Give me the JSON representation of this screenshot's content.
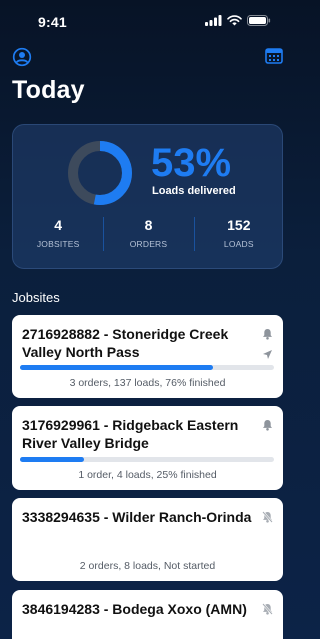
{
  "status_bar": {
    "time": "9:41"
  },
  "header": {
    "title": "Today"
  },
  "summary": {
    "percent_text": "53%",
    "percent_value": 53,
    "percent_label": "Loads delivered",
    "stats": [
      {
        "value": "4",
        "label": "JOBSITES"
      },
      {
        "value": "8",
        "label": "ORDERS"
      },
      {
        "value": "152",
        "label": "LOADS"
      }
    ]
  },
  "jobsites": {
    "section_title": "Jobsites",
    "items": [
      {
        "title": "2716928882 - Stoneridge Creek Valley North Pass",
        "meta": "3 orders, 137 loads, 76% finished",
        "progress": 0.76,
        "icons": [
          "bell-icon",
          "navigation-arrow-icon"
        ]
      },
      {
        "title": "3176929961 - Ridgeback Eastern River Valley Bridge",
        "meta": "1 order, 4 loads, 25% finished",
        "progress": 0.25,
        "icons": [
          "bell-icon"
        ]
      },
      {
        "title": "3338294635 - Wilder Ranch-Orinda",
        "meta": "2 orders, 8 loads, Not started",
        "icons": [
          "bell-slash-icon"
        ]
      },
      {
        "title": "3846194283 - Bodega Xoxo (AMN)",
        "icons": [
          "bell-slash-icon"
        ]
      }
    ]
  },
  "colors": {
    "accent": "#1e7cf2",
    "background": "#0b1f3c",
    "card": "#ffffff",
    "gauge_track": "#3d4a5c"
  }
}
